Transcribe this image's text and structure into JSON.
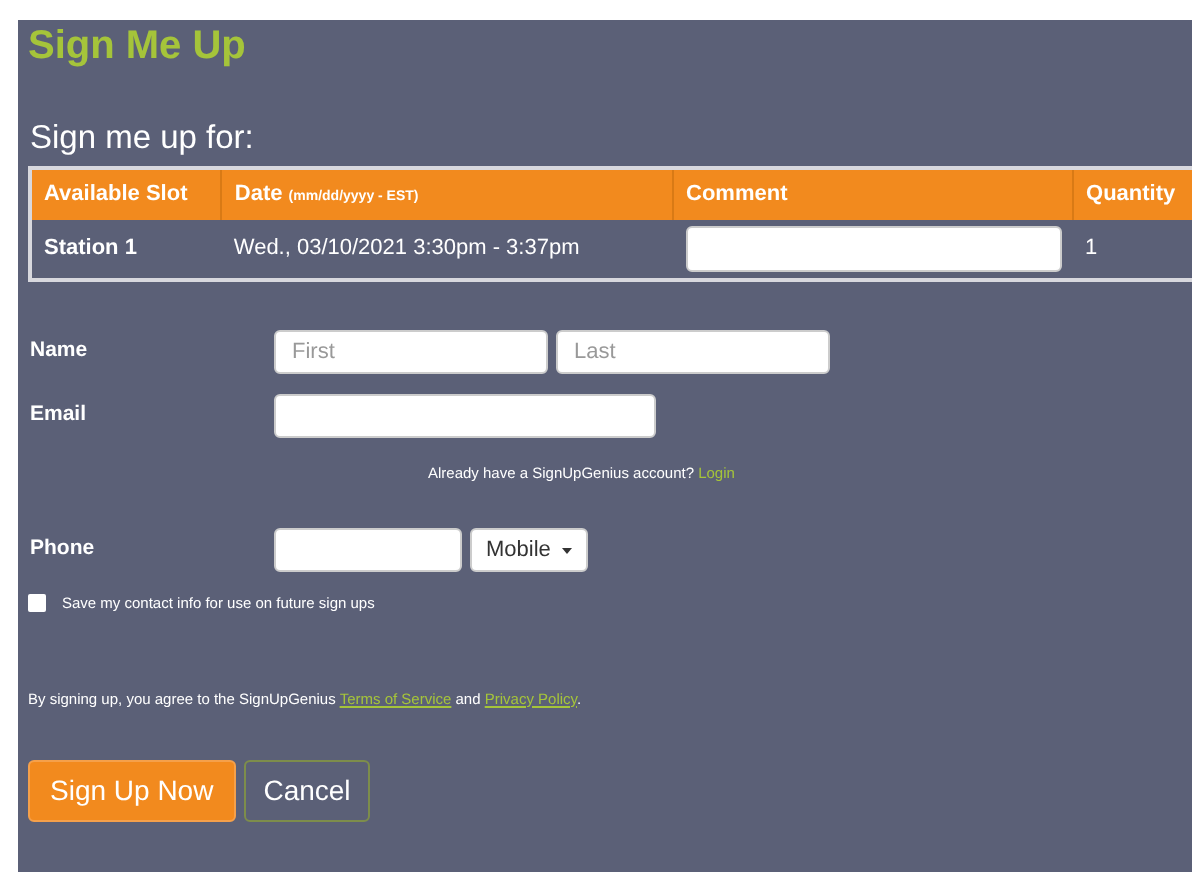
{
  "title": "Sign Me Up",
  "subtitle": "Sign me up for:",
  "table": {
    "columns": [
      {
        "label": "Available Slot"
      },
      {
        "label": "Date",
        "note": "(mm/dd/yyyy - EST)"
      },
      {
        "label": "Comment"
      },
      {
        "label": "Quantity"
      }
    ],
    "rows": [
      {
        "slot": "Station 1",
        "date": "Wed., 03/10/2021 3:30pm - 3:37pm",
        "quantity": "1"
      }
    ]
  },
  "form": {
    "name_label": "Name",
    "first": {
      "placeholder": "First"
    },
    "last": {
      "placeholder": "Last"
    },
    "email_label": "Email",
    "login_prompt": "Already have a SignUpGenius account?",
    "login_link": "Login",
    "phone_label": "Phone",
    "phone_type": "Mobile",
    "save_contact": {
      "label": "Save my contact info for use on future sign ups",
      "checked": false
    },
    "terms": {
      "before": "By signing up, you agree to the SignUpGenius",
      "terms_link": "Terms of Service",
      "middle": "and",
      "privacy_link": "Privacy Policy",
      "after": "."
    }
  },
  "buttons": [
    {
      "label": "Sign Up Now",
      "kind": "primary"
    },
    {
      "label": "Cancel",
      "kind": "secondary"
    }
  ]
}
